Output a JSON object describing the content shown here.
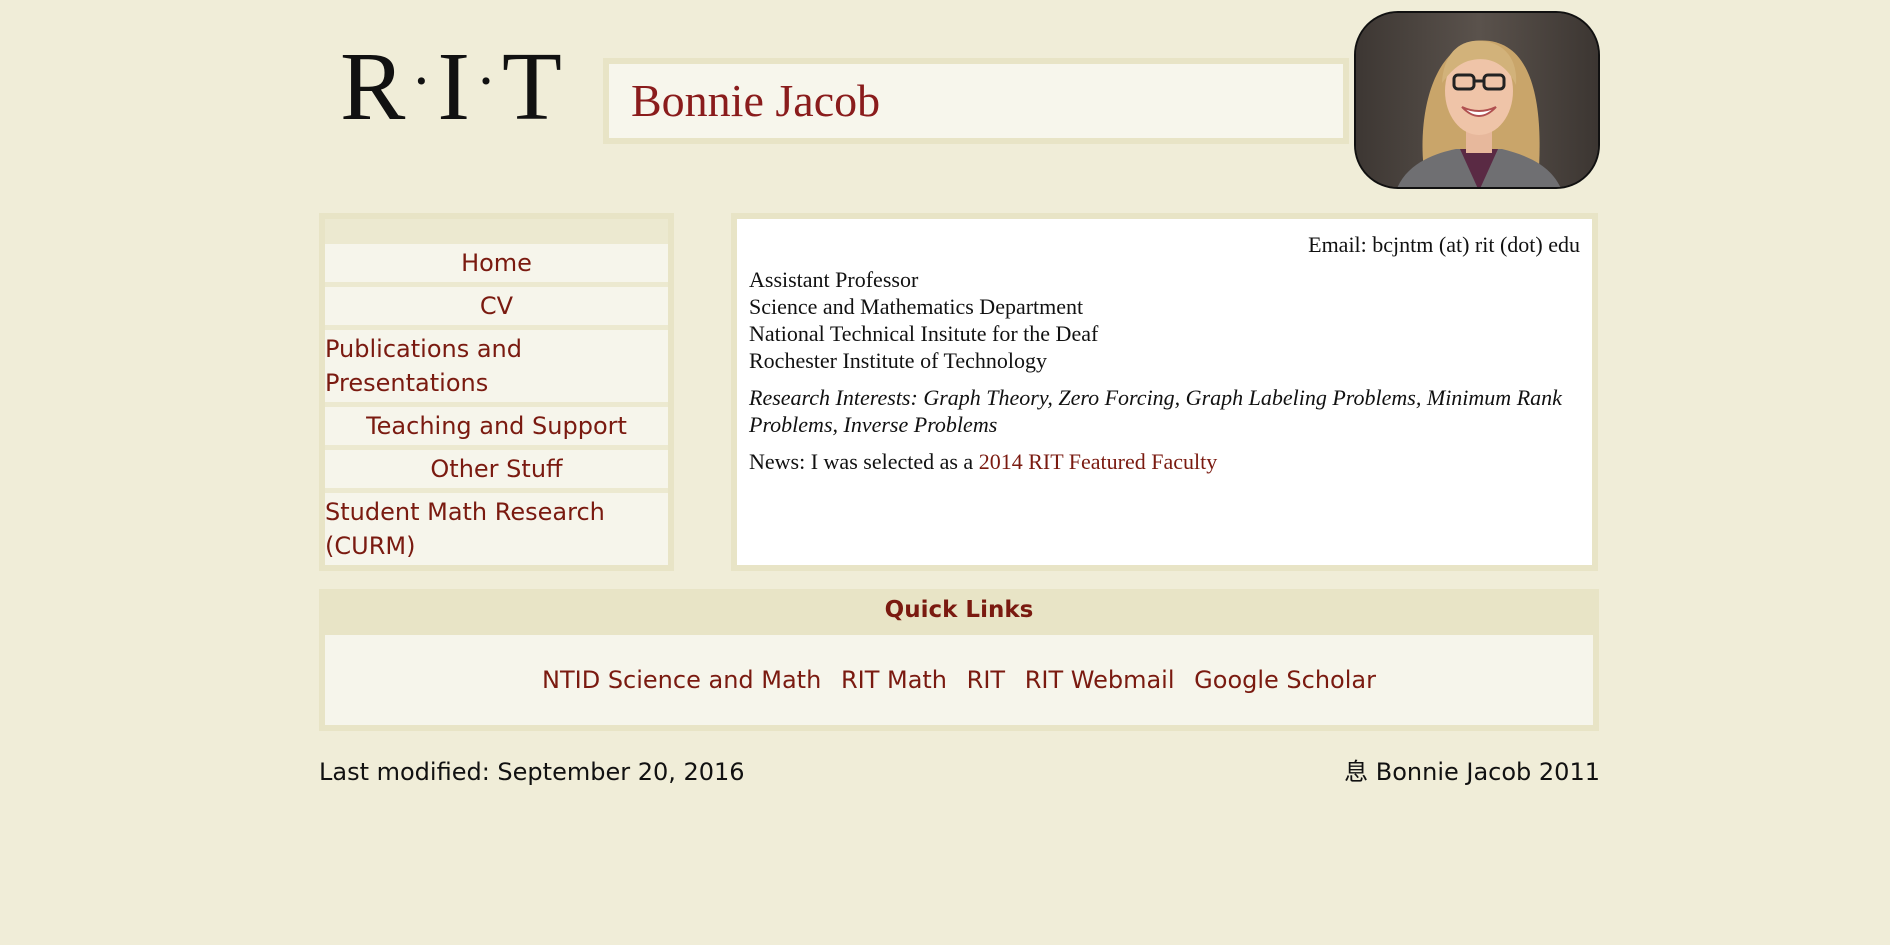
{
  "header": {
    "logo_letters": [
      "R",
      "I",
      "T"
    ],
    "title": "Bonnie Jacob"
  },
  "sidebar": {
    "items": [
      {
        "label": "Home"
      },
      {
        "label": "CV"
      },
      {
        "label": "Publications and Presentations"
      },
      {
        "label": "Teaching and Support"
      },
      {
        "label": "Other Stuff"
      },
      {
        "label": "Student Math Research (CURM)"
      }
    ]
  },
  "content": {
    "email": "Email: bcjntm (at) rit (dot) edu",
    "affiliation": [
      "Assistant Professor",
      "Science and Mathematics Department",
      "National Technical Insitute for the Deaf",
      "Rochester Institute of Technology"
    ],
    "interests": "Research Interests: Graph Theory, Zero Forcing, Graph Labeling Problems, Minimum Rank Problems, Inverse Problems",
    "news_prefix": "News: I was selected as a ",
    "news_link": "2014 RIT Featured Faculty"
  },
  "quick_links": {
    "title": "Quick Links",
    "links": [
      "NTID Science and Math",
      "RIT Math",
      "RIT",
      "RIT Webmail",
      "Google Scholar"
    ]
  },
  "footer": {
    "modified": "Last modified: September 20, 2016",
    "copyright": "息 Bonnie Jacob 2011"
  },
  "colors": {
    "background": "#f0edd8",
    "link": "#7a1a10",
    "title": "#8a1c1c"
  }
}
